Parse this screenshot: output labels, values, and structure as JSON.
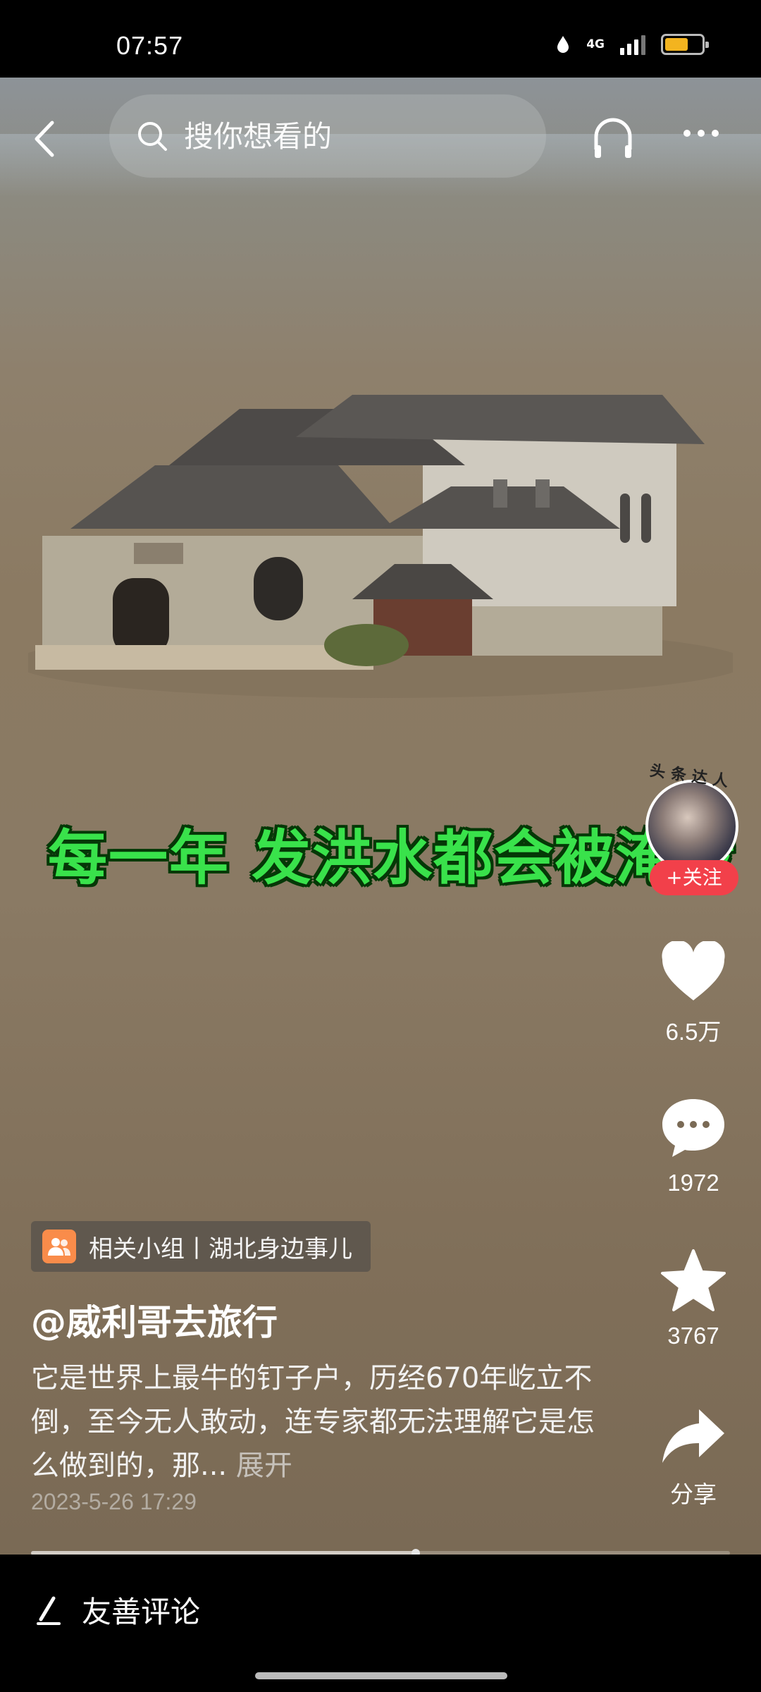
{
  "status_bar": {
    "time": "07:57",
    "network": "4G",
    "battery_color": "#f3b41f"
  },
  "top_bar": {
    "search_placeholder": "搜你想看的"
  },
  "video": {
    "caption": "每一年 发洪水都会被淹没"
  },
  "author_avatar": {
    "badge": "头条达人"
  },
  "actions": {
    "follow_label": "+关注",
    "likes": "6.5万",
    "comments": "1972",
    "favorites": "3767",
    "share_label": "分享"
  },
  "post": {
    "group_tag": "相关小组丨湖北身边事儿",
    "author": "@威利哥去旅行",
    "description": "它是世界上最牛的钉子户，历经670年屹立不倒，至今无人敢动，连专家都无法理解它是怎么做到的，那...",
    "expand_label": "展开",
    "date": "2023-5-26 17:29"
  },
  "progress": {
    "played_fraction": 0.55
  },
  "comment_bar": {
    "label": "友善评论"
  },
  "colors": {
    "caption": "#39e24b",
    "follow": "#f2404a",
    "group_icon": "#f98c4a"
  }
}
